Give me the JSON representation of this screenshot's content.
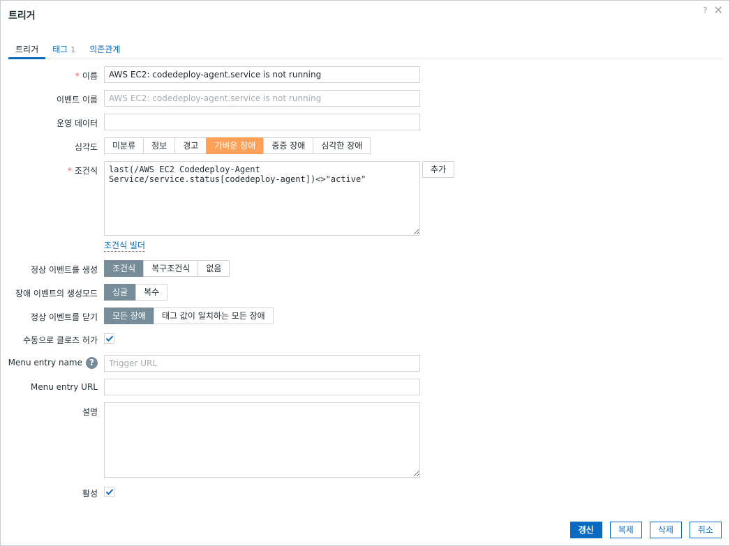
{
  "dialog": {
    "title": "트리거",
    "help_glyph": "?",
    "close_glyph": "✕"
  },
  "tabs": [
    {
      "label": "트리거",
      "active": true
    },
    {
      "label": "태그",
      "count": "1",
      "active": false
    },
    {
      "label": "의존관계",
      "active": false
    }
  ],
  "form": {
    "required_mark": "*",
    "name": {
      "label": "이름",
      "value": "AWS EC2: codedeploy-agent.service is not running"
    },
    "event_name": {
      "label": "이벤트 이름",
      "placeholder": "AWS EC2: codedeploy-agent.service is not running"
    },
    "opdata": {
      "label": "운영 데이터",
      "value": ""
    },
    "severity": {
      "label": "심각도",
      "options": [
        "미분류",
        "정보",
        "경고",
        "가벼운 장애",
        "중증 장애",
        "심각한 장애"
      ],
      "selected": "가벼운 장애"
    },
    "expression": {
      "label": "조건식",
      "value": "last(/AWS EC2 Codedeploy-Agent\nService/service.status[codedeploy-agent])<>\"active\"",
      "add_label": "추가",
      "builder_label": "조건식 빌더"
    },
    "recovery_mode": {
      "label": "정상 이벤트를 생성",
      "options": [
        "조건식",
        "복구조건식",
        "없음"
      ],
      "selected": "조건식"
    },
    "event_mode": {
      "label": "장애 이벤트의 생성모드",
      "options": [
        "싱글",
        "복수"
      ],
      "selected": "싱글"
    },
    "ok_close": {
      "label": "정상 이벤트를 닫기",
      "options": [
        "모든 장애",
        "태그 값이 일치하는 모든 장애"
      ],
      "selected": "모든 장애"
    },
    "manual_close": {
      "label": "수동으로 클로즈 허가",
      "checked": true
    },
    "menu_entry_name": {
      "label": "Menu entry name",
      "help_glyph": "?",
      "placeholder": "Trigger URL"
    },
    "menu_entry_url": {
      "label": "Menu entry URL",
      "value": ""
    },
    "description": {
      "label": "설명",
      "value": ""
    },
    "enabled": {
      "label": "활성",
      "checked": true
    }
  },
  "footer": {
    "update": "갱신",
    "clone": "복제",
    "delete": "삭제",
    "cancel": "취소"
  },
  "colors": {
    "accent": "#0b6ac0",
    "severity_selected": "#ffa059",
    "toggle_selected": "#768d99",
    "required": "#e45959"
  }
}
